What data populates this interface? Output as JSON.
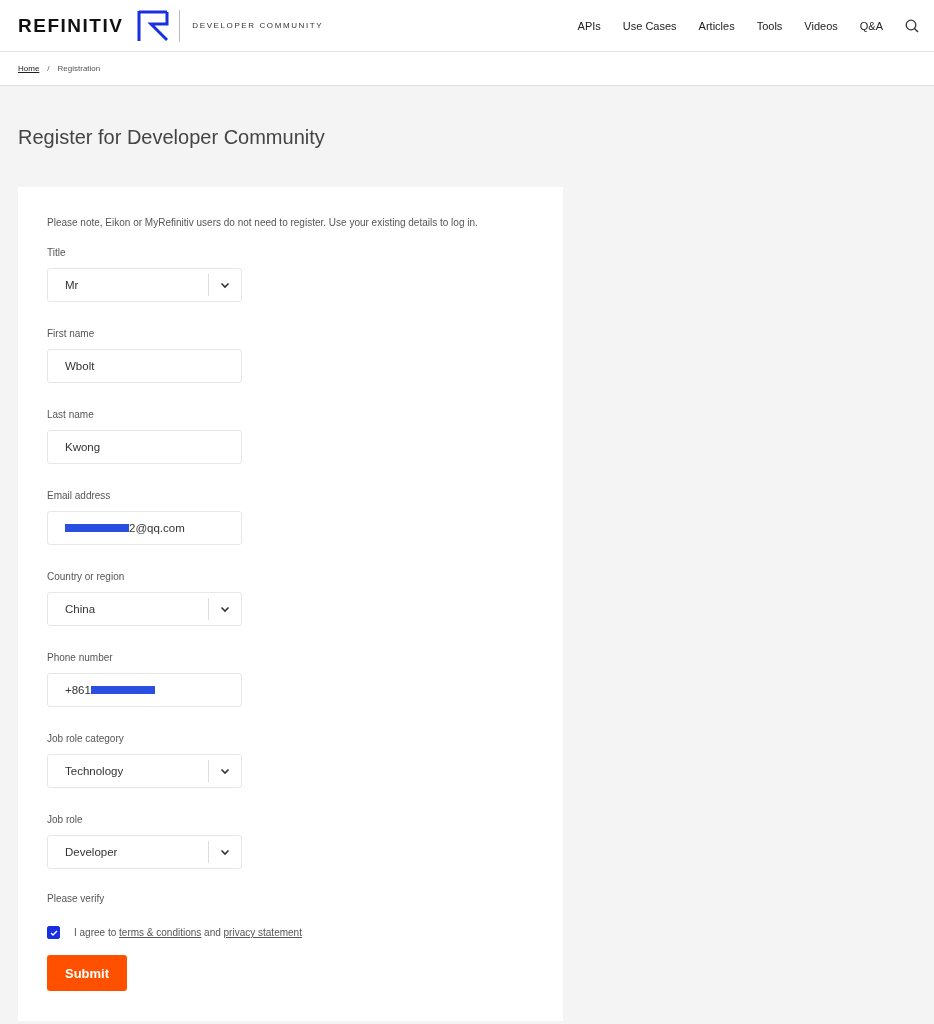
{
  "header": {
    "brand": "REFINITIV",
    "community": "DEVELOPER COMMUNITY",
    "nav": [
      {
        "label": "APIs"
      },
      {
        "label": "Use Cases"
      },
      {
        "label": "Articles"
      },
      {
        "label": "Tools"
      },
      {
        "label": "Videos"
      },
      {
        "label": "Q&A"
      }
    ]
  },
  "breadcrumb": [
    {
      "label": "Home",
      "kind": "link"
    },
    {
      "label": "/",
      "kind": "separator"
    },
    {
      "label": "Registration",
      "kind": "current"
    }
  ],
  "page_title": "Register for Developer Community",
  "form": {
    "note": "Please note, Eikon or MyRefinitiv users do not need to register. Use your existing details to log in.",
    "fields": [
      {
        "label": "Title",
        "kind": "select",
        "value": "Mr"
      },
      {
        "label": "First name",
        "kind": "text",
        "value": "Wbolt"
      },
      {
        "label": "Last name",
        "kind": "text",
        "value": "Kwong"
      },
      {
        "label": "Email address",
        "kind": "text",
        "value": "2@qq.com",
        "redacted_before": true
      },
      {
        "label": "Country or region",
        "kind": "select",
        "value": "China"
      },
      {
        "label": "Phone number",
        "kind": "text",
        "value": "+861",
        "redacted_after": true
      },
      {
        "label": "Job role category",
        "kind": "select",
        "value": "Technology"
      },
      {
        "label": "Job role",
        "kind": "select",
        "value": "Developer"
      }
    ],
    "verify_label": "Please verify",
    "agreement": {
      "checked": true,
      "parts": [
        {
          "kind": "text",
          "text": "I agree to"
        },
        {
          "kind": "link",
          "text": "terms & conditions"
        },
        {
          "kind": "text",
          "text": "and"
        },
        {
          "kind": "link",
          "text": "privacy statement"
        }
      ]
    },
    "submit": "Submit"
  }
}
